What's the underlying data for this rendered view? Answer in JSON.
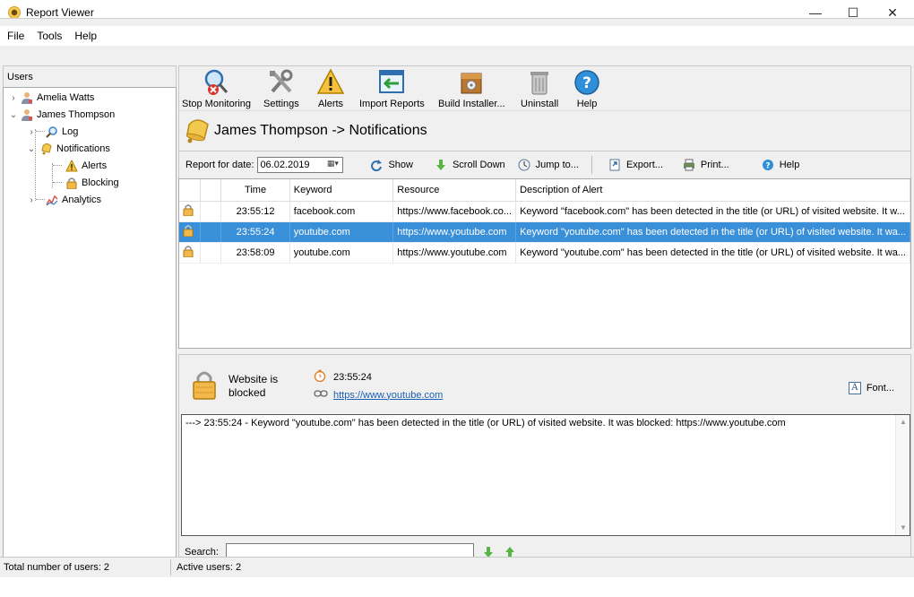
{
  "window": {
    "title": "Report Viewer",
    "minimize": "—",
    "maximize": "☐",
    "close": "✕"
  },
  "menu": [
    "File",
    "Tools",
    "Help"
  ],
  "users_panel": {
    "header": "Users",
    "tree": [
      {
        "label": "Amelia Watts",
        "icon": "user-icon",
        "expanded": false
      },
      {
        "label": "James Thompson",
        "icon": "user-icon",
        "expanded": true
      },
      {
        "label": "Log",
        "icon": "magnifier-icon"
      },
      {
        "label": "Notifications",
        "icon": "bell-icon",
        "expanded": true
      },
      {
        "label": "Alerts",
        "icon": "warning-icon"
      },
      {
        "label": "Blocking",
        "icon": "lock-icon"
      },
      {
        "label": "Analytics",
        "icon": "chart-icon",
        "expanded": false
      }
    ]
  },
  "toolbar": [
    {
      "label": "Stop Monitoring",
      "icon": "stop-monitoring-icon"
    },
    {
      "label": "Settings",
      "icon": "tools-icon"
    },
    {
      "label": "Alerts",
      "icon": "warning-icon"
    },
    {
      "label": "Import Reports",
      "icon": "import-icon"
    },
    {
      "label": "Build Installer...",
      "icon": "installer-box-icon"
    },
    {
      "label": "Uninstall",
      "icon": "trash-can-icon"
    },
    {
      "label": "Help",
      "icon": "help-icon"
    }
  ],
  "section": {
    "title": "James Thompson -> Notifications"
  },
  "report_bar": {
    "date_label": "Report for date:",
    "date_value": "06.02.2019",
    "show": "Show",
    "scroll_down": "Scroll Down",
    "jump_to": "Jump to...",
    "export": "Export...",
    "print": "Print...",
    "help": "Help"
  },
  "table": {
    "columns": [
      "",
      "",
      "Time",
      "Keyword",
      "Resource",
      "Description of Alert"
    ],
    "rows": [
      {
        "time": "23:55:12",
        "keyword": "facebook.com",
        "resource": "https://www.facebook.co...",
        "description": "Keyword \"facebook.com\" has been detected in the title (or URL) of visited website. It w...",
        "selected": false
      },
      {
        "time": "23:55:24",
        "keyword": "youtube.com",
        "resource": "https://www.youtube.com",
        "description": "Keyword \"youtube.com\" has been detected in the title (or URL) of visited website. It wa...",
        "selected": true
      },
      {
        "time": "23:58:09",
        "keyword": "youtube.com",
        "resource": "https://www.youtube.com",
        "description": "Keyword \"youtube.com\" has been detected in the title (or URL) of visited website. It wa...",
        "selected": false
      }
    ]
  },
  "detail": {
    "status": "Website is blocked",
    "time": "23:55:24",
    "url": "https://www.youtube.com",
    "font_button": "Font...",
    "log_text": "---> 23:55:24 - Keyword \"youtube.com\" has been detected in the title (or URL) of visited website. It was blocked: https://www.youtube.com",
    "search_label": "Search:",
    "search_value": ""
  },
  "statusbar": {
    "total": "Total number of users: 2",
    "active": "Active users: 2"
  },
  "colors": {
    "selection": "#3a8fd9",
    "panel": "#f0f0f0",
    "link": "#1a5fb4"
  }
}
